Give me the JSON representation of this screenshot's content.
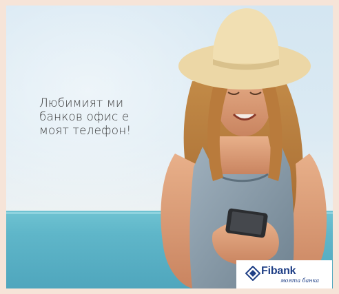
{
  "headline": {
    "lines": [
      "Любимият ми",
      "банков офис е",
      "моят телефон!"
    ]
  },
  "brand": {
    "name": "Fibank",
    "tagline": "моята банка",
    "color": "#1f3f86"
  },
  "icons": {
    "logo": "fibank-logo-icon"
  },
  "colors": {
    "frame": "#f6e4d8",
    "sky": "#d4e6f2",
    "sea": "#5fb6c9",
    "text": "#3a3a3a"
  }
}
